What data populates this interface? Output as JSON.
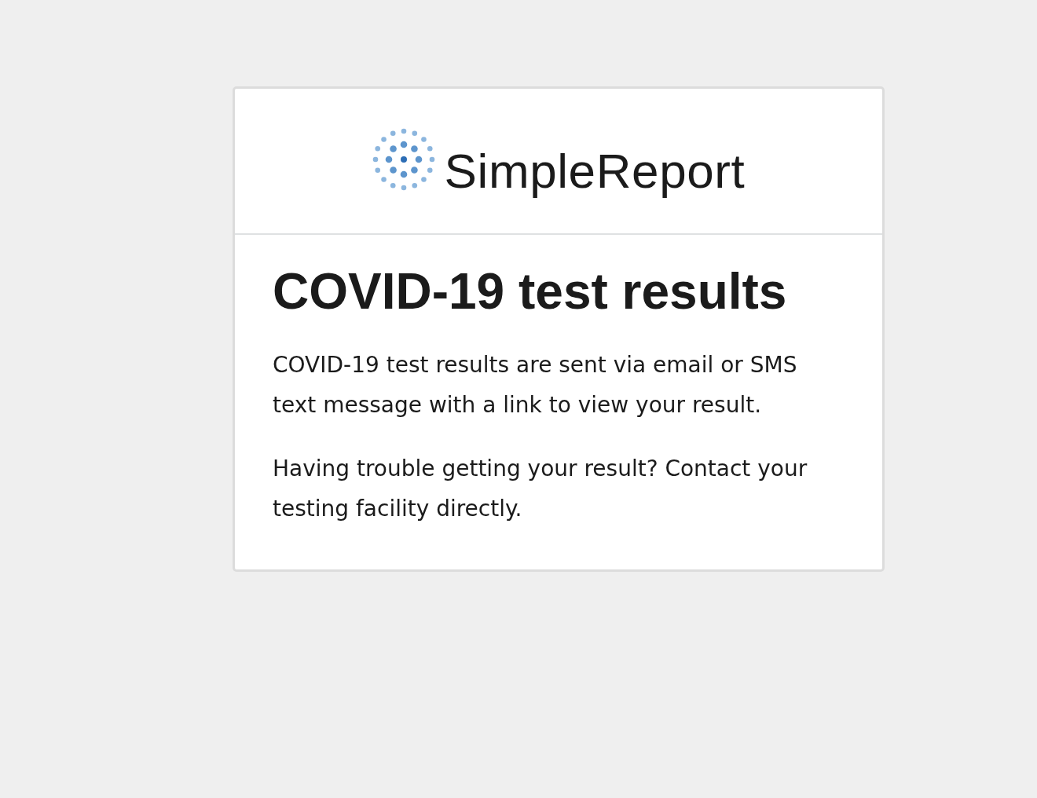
{
  "header": {
    "logo_text": "SimpleReport"
  },
  "main": {
    "title": "COVID-19 test results",
    "paragraphs": [
      "COVID-19 test results are sent via email or SMS text message with a link to view your result.",
      "Having trouble getting your result? Contact your testing facility directly."
    ]
  }
}
